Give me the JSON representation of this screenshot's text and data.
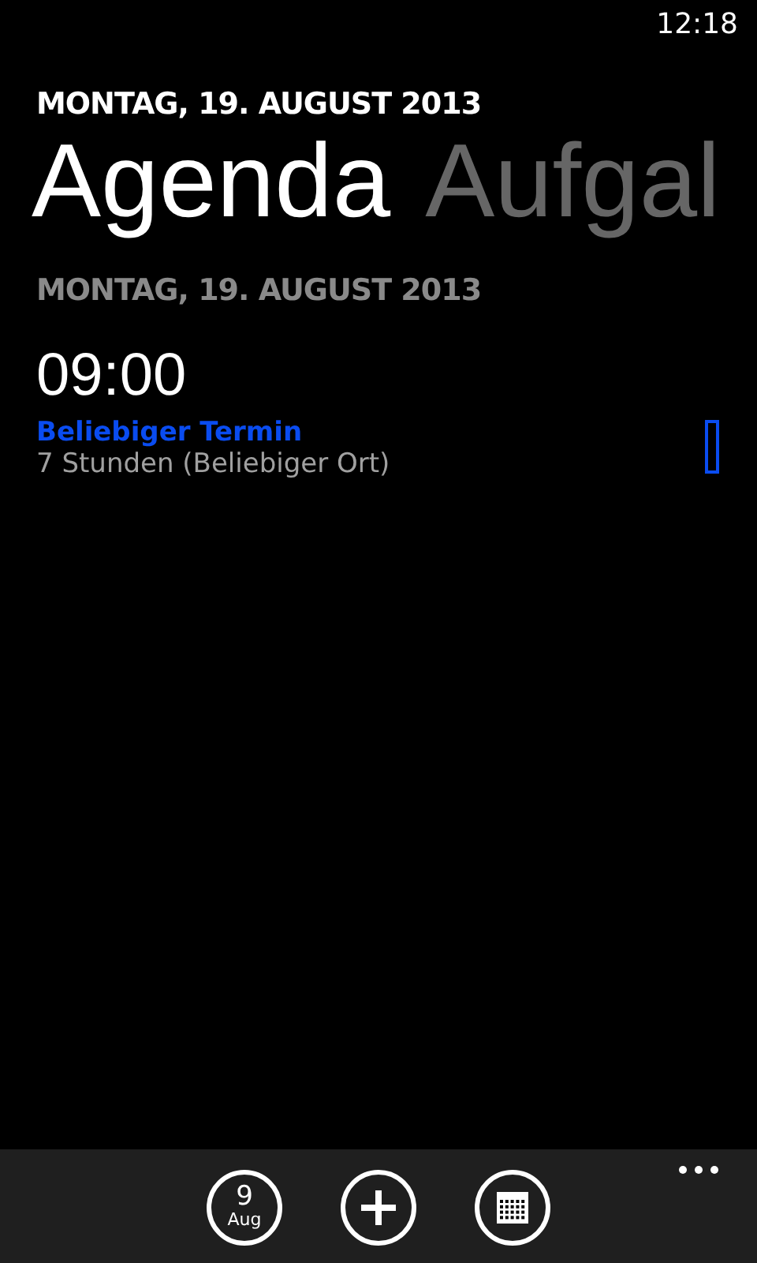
{
  "status_bar": {
    "time": "12:18"
  },
  "header": {
    "date": "MONTAG, 19. AUGUST 2013"
  },
  "pivots": [
    {
      "label": "Agenda",
      "selected": true
    },
    {
      "label": "Aufgal",
      "selected": false
    }
  ],
  "agenda": {
    "day": "MONTAG, 19. AUGUST 2013",
    "groups": [
      {
        "time": "09:00",
        "events": [
          {
            "title": "Beliebiger Termin",
            "detail": "7 Stunden (Beliebiger Ort)",
            "color": "#0a4cf0"
          }
        ]
      }
    ]
  },
  "app_bar": {
    "buttons": [
      {
        "kind": "date",
        "day": "9",
        "month": "Aug"
      },
      {
        "kind": "add"
      },
      {
        "kind": "calendar"
      }
    ]
  }
}
